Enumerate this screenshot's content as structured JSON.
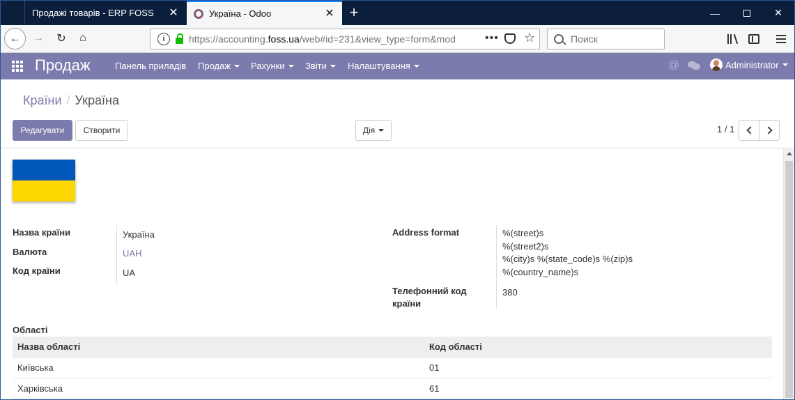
{
  "browser": {
    "tabs": [
      {
        "title": "Продажі товарів - ERP FOSS",
        "active": false
      },
      {
        "title": "Україна - Odoo",
        "active": true
      }
    ],
    "url": {
      "prefix": "https://accounting.",
      "domain": "foss.ua",
      "rest": "/web#id=231&view_type=form&mod"
    },
    "search_placeholder": "Поиск"
  },
  "app": {
    "brand": "Продаж",
    "menu": [
      "Панель приладів",
      "Продаж",
      "Рахунки",
      "Звіти",
      "Налаштування"
    ],
    "user": "Administrator",
    "accent_color": "#7c7bad"
  },
  "control_panel": {
    "breadcrumb_parent": "Країни",
    "breadcrumb_current": "Україна",
    "edit_label": "Редагувати",
    "create_label": "Створити",
    "action_label": "Дія",
    "pager": "1 / 1"
  },
  "form": {
    "flag": {
      "top_color": "#0057b8",
      "bottom_color": "#ffd700"
    },
    "country_name_label": "Назва країни",
    "country_name": "Україна",
    "currency_label": "Валюта",
    "currency": "UAH",
    "country_code_label": "Код країни",
    "country_code": "UA",
    "address_format_label": "Address format",
    "address_format": [
      "%(street)s",
      "%(street2)s",
      "%(city)s %(state_code)s %(zip)s",
      "%(country_name)s"
    ],
    "phone_code_label": "Телефонний код країни",
    "phone_code": "380",
    "states_label": "Області",
    "states_columns": [
      "Назва області",
      "Код області"
    ],
    "states": [
      [
        "Київська",
        "01"
      ],
      [
        "Харківська",
        "61"
      ]
    ]
  }
}
